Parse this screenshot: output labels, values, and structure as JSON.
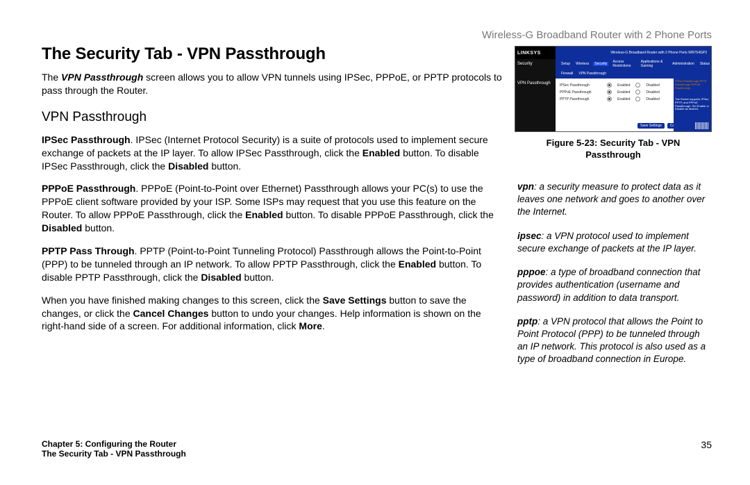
{
  "header_right": "Wireless-G Broadband Router with 2 Phone Ports",
  "title": "The Security Tab - VPN Passthrough",
  "intro_pre": "The ",
  "intro_term": "VPN Passthrough",
  "intro_post": " screen allows you to allow VPN tunnels using IPSec, PPPoE, or PPTP protocols to pass through the Router.",
  "section_heading": "VPN Passthrough",
  "ipsec_label": "IPSec Passthrough",
  "ipsec_text1": ". IPSec (Internet Protocol Security) is a suite of protocols used to implement secure exchange of packets at the IP layer. To allow IPSec Passthrough, click the ",
  "enabled_word": "Enabled",
  "ipsec_text2": " button. To disable IPSec Passthrough, click the ",
  "disabled_word": "Disabled",
  "ipsec_text3": " button.",
  "pppoe_label": "PPPoE Passthrough",
  "pppoe_text1": ". PPPoE (Point-to-Point over Ethernet) Passthrough allows your PC(s) to use the PPPoE client software provided by your ISP. Some ISPs may request that you use this feature on the Router. To allow PPPoE Passthrough, click the ",
  "pppoe_text2": " button. To disable PPPoE Passthrough, click the ",
  "pppoe_text3": " button.",
  "pptp_label": "PPTP Pass Through",
  "pptp_text1": ". PPTP (Point-to-Point Tunneling Protocol) Passthrough allows the Point-to-Point (PPP) to be tunneled through an IP network. To allow PPTP Passthrough, click the ",
  "pptp_text2": " button. To disable PPTP Passthrough, click the ",
  "pptp_text3": " button.",
  "closing_text1": "When you have finished making changes to this screen, click the ",
  "save_word": "Save Settings",
  "closing_text2": " button to save the changes, or click the ",
  "cancel_word": "Cancel Changes",
  "closing_text3": " button to undo your changes. Help information is shown on the right-hand side of a screen. For additional information, click ",
  "more_word": "More",
  "closing_text4": ".",
  "figure_caption_line1": "Figure 5-23: Security Tab - VPN",
  "figure_caption_line2": "Passthrough",
  "fig": {
    "logo": "LINKSYS",
    "banner": "Wireless-G Broadband Router with 2 Phone Ports   WRT54GP2",
    "left1": "Security",
    "left2": "VPN Passthrough",
    "nav": [
      "Setup",
      "Wireless",
      "Security",
      "Access Restrictions",
      "Applications & Gaming",
      "Administration",
      "Status"
    ],
    "subnav": [
      "Firewall",
      "VPN Passthrough"
    ],
    "row1": "IPSec Passthrough",
    "row2": "PPPoE Passthrough",
    "row3": "PPTP Passthrough",
    "en": "Enabled",
    "dis": "Disabled",
    "save": "Save Settings",
    "cancel": "Cancel Changes",
    "side_top": "IPSec Passthrough\nPPTP Passthrough\nPPPoE Passthrough",
    "side_text": "The Router supports IPSec, PPTP, and PPPoE Passthrough. Set Enable or Disable as desired."
  },
  "defs": {
    "vpn_term": "vpn",
    "vpn_body": ": a security measure to protect data as it leaves one network and goes to another over the Internet.",
    "ipsec_term": "ipsec",
    "ipsec_body": ": a VPN protocol used to implement secure exchange of packets at the IP layer.",
    "pppoe_term": "pppoe",
    "pppoe_body": ": a type of broadband connection that provides authentication (username and password) in addition to data transport.",
    "pptp_term": "pptp",
    "pptp_body": ": a VPN protocol that allows the Point to Point Protocol (PPP) to be tunneled through an IP network. This protocol is also used as a type of broadband connection in Europe."
  },
  "footer": {
    "chapter": "Chapter 5: Configuring the Router",
    "subline": "The Security Tab - VPN Passthrough",
    "page": "35"
  }
}
